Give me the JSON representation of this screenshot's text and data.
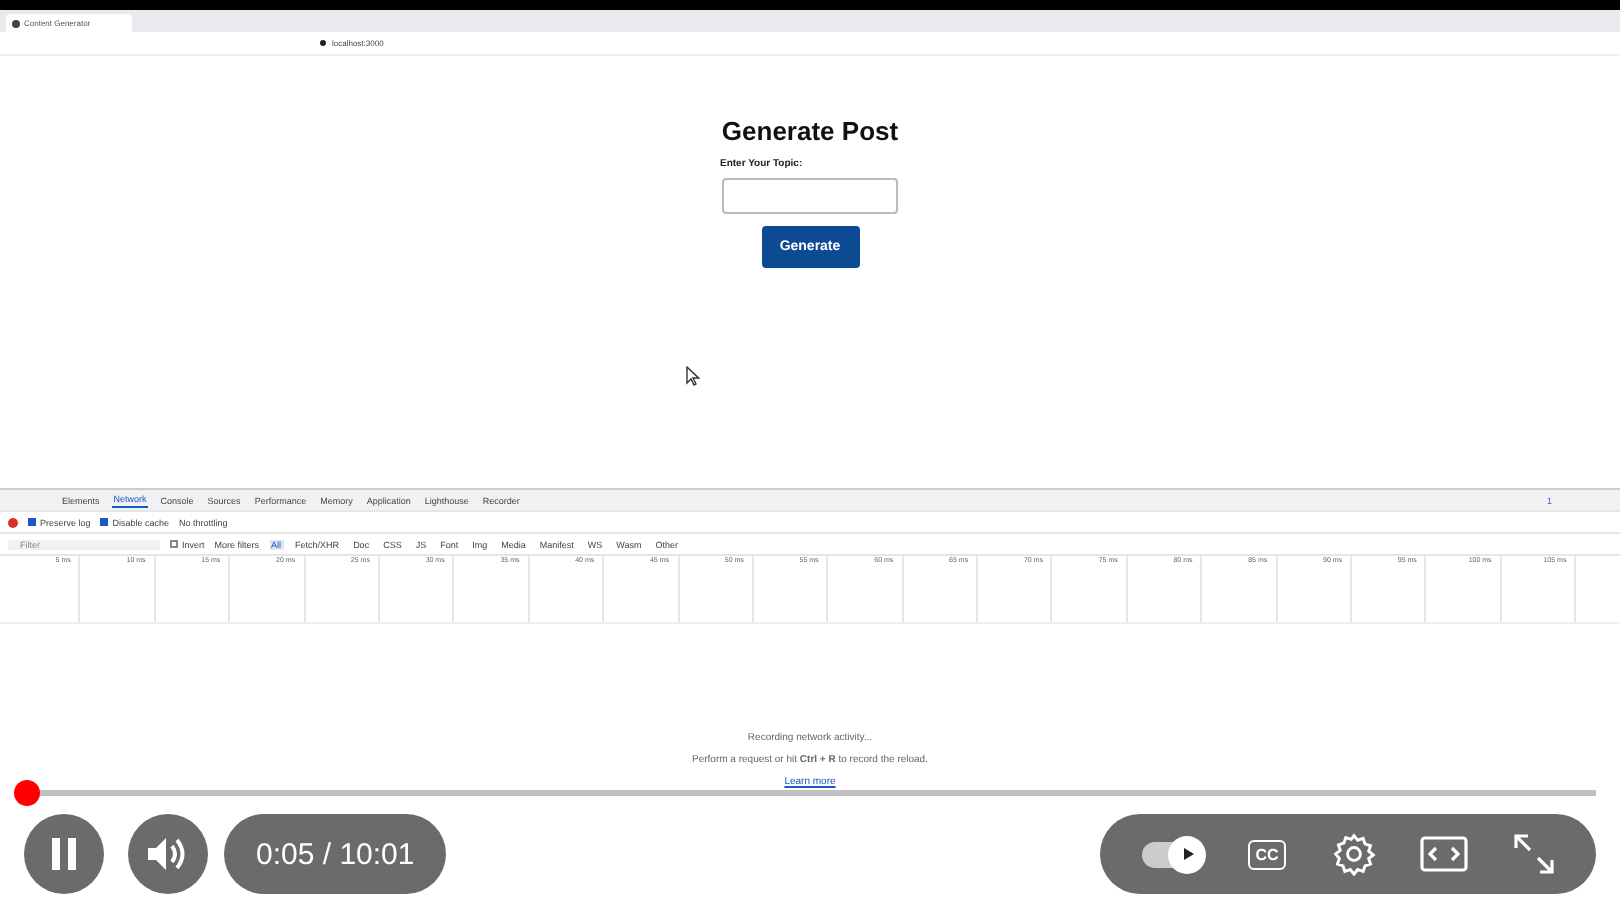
{
  "browser": {
    "tab_title": "Content Generator",
    "url": "localhost:3000"
  },
  "page": {
    "title": "Generate Post",
    "label": "Enter Your Topic:",
    "button": "Generate"
  },
  "devtools": {
    "tabs": [
      {
        "label": "Elements",
        "selected": false
      },
      {
        "label": "Network",
        "selected": true
      },
      {
        "label": "Console",
        "selected": false
      },
      {
        "label": "Sources",
        "selected": false
      },
      {
        "label": "Performance",
        "selected": false
      },
      {
        "label": "Memory",
        "selected": false
      },
      {
        "label": "Application",
        "selected": false
      },
      {
        "label": "Lighthouse",
        "selected": false
      },
      {
        "label": "Recorder",
        "selected": false
      }
    ],
    "issues": "1",
    "preserve_log": {
      "label": "Preserve log",
      "checked": true
    },
    "disable_cache": {
      "label": "Disable cache",
      "checked": true
    },
    "throttling": "No throttling",
    "filter": {
      "placeholder": "Filter"
    },
    "invert": {
      "label": "Invert",
      "checked": false
    },
    "more_filters": "More filters",
    "type_filters": [
      {
        "label": "All",
        "selected": true
      },
      {
        "label": "Fetch/XHR",
        "selected": false
      },
      {
        "label": "Doc",
        "selected": false
      },
      {
        "label": "CSS",
        "selected": false
      },
      {
        "label": "JS",
        "selected": false
      },
      {
        "label": "Font",
        "selected": false
      },
      {
        "label": "Img",
        "selected": false
      },
      {
        "label": "Media",
        "selected": false
      },
      {
        "label": "Manifest",
        "selected": false
      },
      {
        "label": "WS",
        "selected": false
      },
      {
        "label": "Wasm",
        "selected": false
      },
      {
        "label": "Other",
        "selected": false
      }
    ],
    "ticks": [
      "5 ms",
      "10 ms",
      "15 ms",
      "20 ms",
      "25 ms",
      "30 ms",
      "35 ms",
      "40 ms",
      "45 ms",
      "50 ms",
      "55 ms",
      "60 ms",
      "65 ms",
      "70 ms",
      "75 ms",
      "80 ms",
      "85 ms",
      "90 ms",
      "95 ms",
      "100 ms",
      "105 ms"
    ],
    "empty_state": {
      "status": "Recording network activity...",
      "hint": "Perform a request or hit **Ctrl + R** to record the reload.",
      "link": "Learn more"
    }
  },
  "player": {
    "progress": {
      "level": 0.009
    },
    "playing": true,
    "time": "0:05 / 10:01",
    "autoplay": {
      "on": true
    },
    "captions": "CC"
  }
}
